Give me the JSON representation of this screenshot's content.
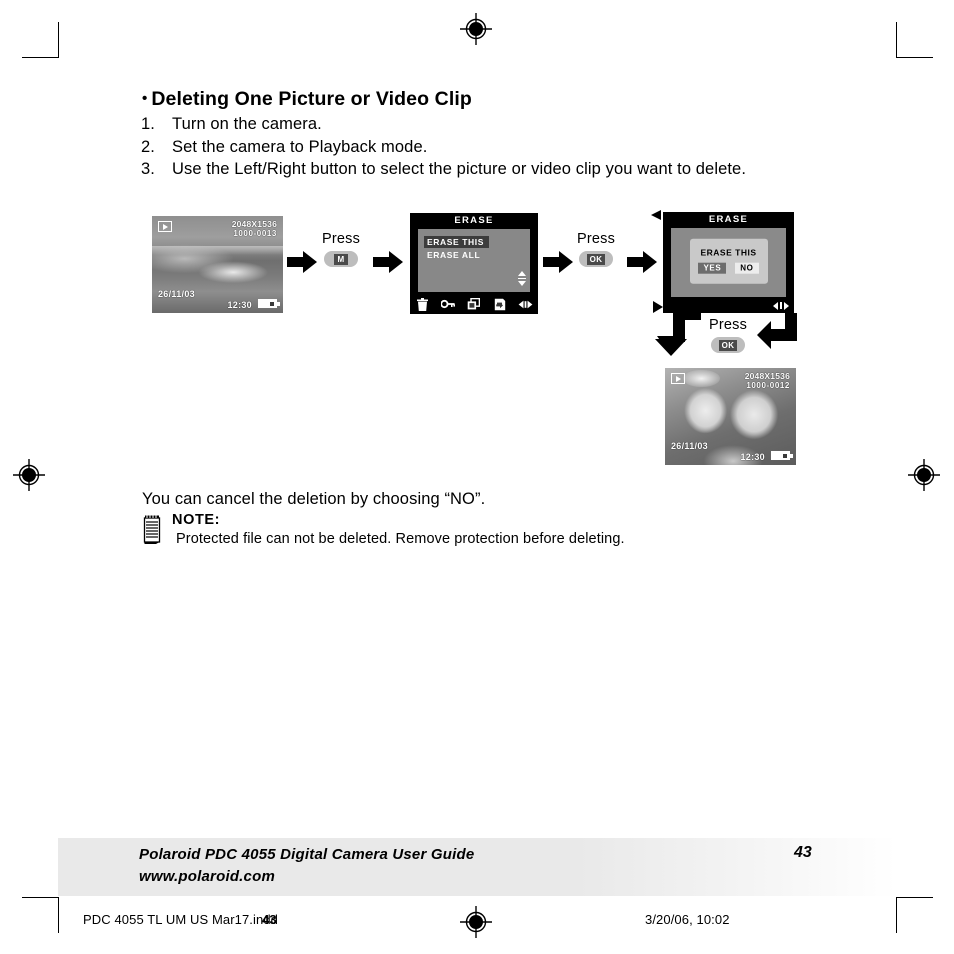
{
  "document": {
    "heading": "Deleting One Picture or Video Clip",
    "heading_bullet": "•",
    "steps": [
      {
        "num": "1.",
        "text": "Turn on the camera."
      },
      {
        "num": "2.",
        "text": "Set the camera to Playback mode."
      },
      {
        "num": "3.",
        "text": "Use the Left/Right button to select the picture or video clip you want to delete."
      }
    ],
    "cancel_note": "You can cancel the deletion by choosing “NO”.",
    "note_label": "NOTE:",
    "note_text": "Protected file can not be deleted. Remove protection before deleting."
  },
  "flow": {
    "screen1": {
      "playback_icon": "playback-icon",
      "resolution": "2048X1536",
      "file_number": "1000-0013",
      "date": "26/11/03",
      "time": "12:30",
      "battery_icon": "battery-icon"
    },
    "screen2": {
      "title": "ERASE",
      "items": [
        {
          "label": "ERASE THIS",
          "selected": true
        },
        {
          "label": "ERASE ALL",
          "selected": false
        }
      ],
      "scroll_indicator": "up-down-arrows-icon",
      "toolbar_icons": [
        "trash-icon",
        "key-icon",
        "copy-icon",
        "transfer-icon",
        "left-right-arrows-icon"
      ]
    },
    "screen3": {
      "title": "ERASE",
      "prompt": "ERASE THIS",
      "buttons": [
        {
          "label": "YES",
          "selected": true
        },
        {
          "label": "NO",
          "selected": false
        }
      ],
      "lr_indicator": "left-right-arrows-icon"
    },
    "screen4": {
      "playback_icon": "playback-icon",
      "resolution": "2048X1536",
      "file_number": "1000-0012",
      "date": "26/11/03",
      "time": "12:30",
      "battery_icon": "battery-icon"
    },
    "press_steps": [
      {
        "label": "Press",
        "key": "M"
      },
      {
        "label": "Press",
        "key": "OK"
      },
      {
        "label": "Press",
        "key": "OK"
      }
    ]
  },
  "footer": {
    "line1": "Polaroid PDC 4055 Digital Camera User Guide",
    "line2": "www.polaroid.com",
    "page_number": "43"
  },
  "print_info": {
    "file_name": "PDC 4055 TL UM US Mar17.indd",
    "page_mark": "43",
    "timestamp": "3/20/06, 10:02"
  },
  "marks": {
    "registration": "registration-mark",
    "crop": "crop-mark"
  }
}
